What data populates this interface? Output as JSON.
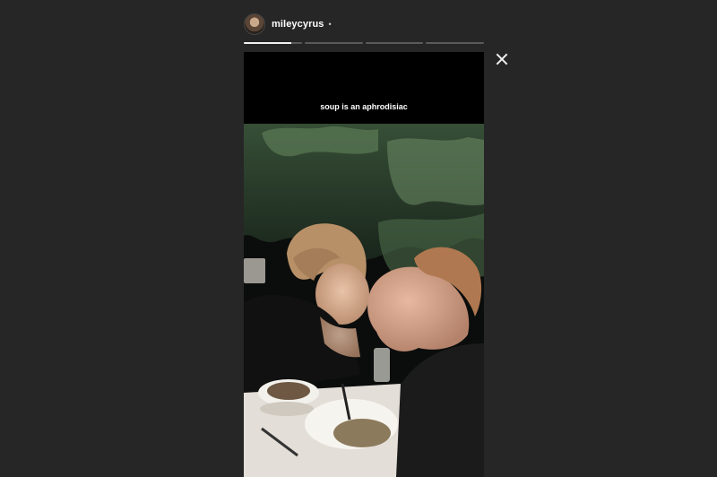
{
  "header": {
    "username": "mileycyrus",
    "separator": "•",
    "avatar_icon": "profile-avatar"
  },
  "progress": {
    "segments": 4,
    "current_segment_fill": 0.82
  },
  "story": {
    "caption": "soup is an aphrodisiac"
  },
  "controls": {
    "close_icon": "close-icon"
  },
  "colors": {
    "background": "#262626",
    "story_bg": "#000000",
    "text": "#ffffff",
    "progress_track": "#5a5a5a",
    "progress_fill": "#f2f2f2"
  }
}
